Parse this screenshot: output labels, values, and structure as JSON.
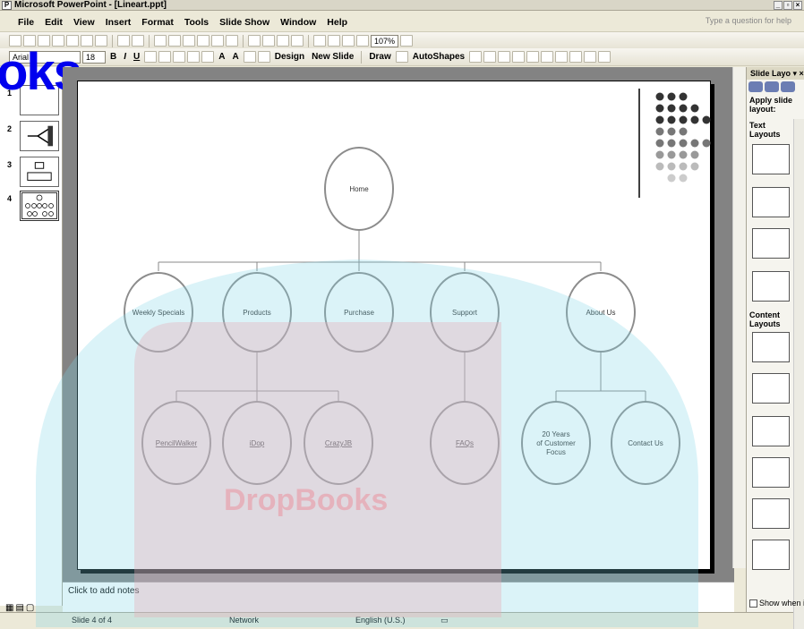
{
  "window": {
    "title": "Microsoft PowerPoint - [Lineart.ppt]"
  },
  "menubar": {
    "items": [
      "File",
      "Edit",
      "View",
      "Insert",
      "Format",
      "Tools",
      "Slide Show",
      "Window",
      "Help"
    ],
    "help_placeholder": "Type a question for help"
  },
  "toolbar": {
    "zoom": "107%",
    "font": "Arial",
    "font_size": "18",
    "design_label": "Design",
    "new_slide_label": "New Slide",
    "draw_label": "Draw",
    "autoshapes_label": "AutoShapes"
  },
  "logo_text": "oks",
  "slides_panel": {
    "numbers": [
      "1",
      "2",
      "3",
      "4"
    ]
  },
  "slide": {
    "root": "Home",
    "level1": [
      "Weekly Specials",
      "Products",
      "Purchase",
      "Support",
      "About Us"
    ],
    "level2": [
      {
        "label": "PencilWalker",
        "parent": "Products"
      },
      {
        "label": "iDop",
        "parent": "Products"
      },
      {
        "label": "CrazyJB",
        "parent": "Products"
      },
      {
        "label": "FAQs",
        "parent": "Support"
      },
      {
        "label": "20 Years of Customer Focus",
        "parent": "About Us"
      },
      {
        "label": "Contact Us",
        "parent": "About Us"
      }
    ],
    "watermark_text": "DropBooks"
  },
  "notes": {
    "placeholder": "Click to add notes"
  },
  "statusbar": {
    "slide": "Slide 4 of 4",
    "template": "Network",
    "language": "English (U.S.)"
  },
  "taskpane": {
    "title": "Slide Layo",
    "apply": "Apply slide layout:",
    "text_layouts": "Text Layouts",
    "content_layouts": "Content Layouts",
    "show_when": "Show when inse"
  },
  "colors": {
    "node_stroke": "#8c8c8c",
    "watermark_cyan": "#7fd4e6",
    "watermark_red": "#e7a9b4",
    "logo_blue": "#0000ee"
  }
}
